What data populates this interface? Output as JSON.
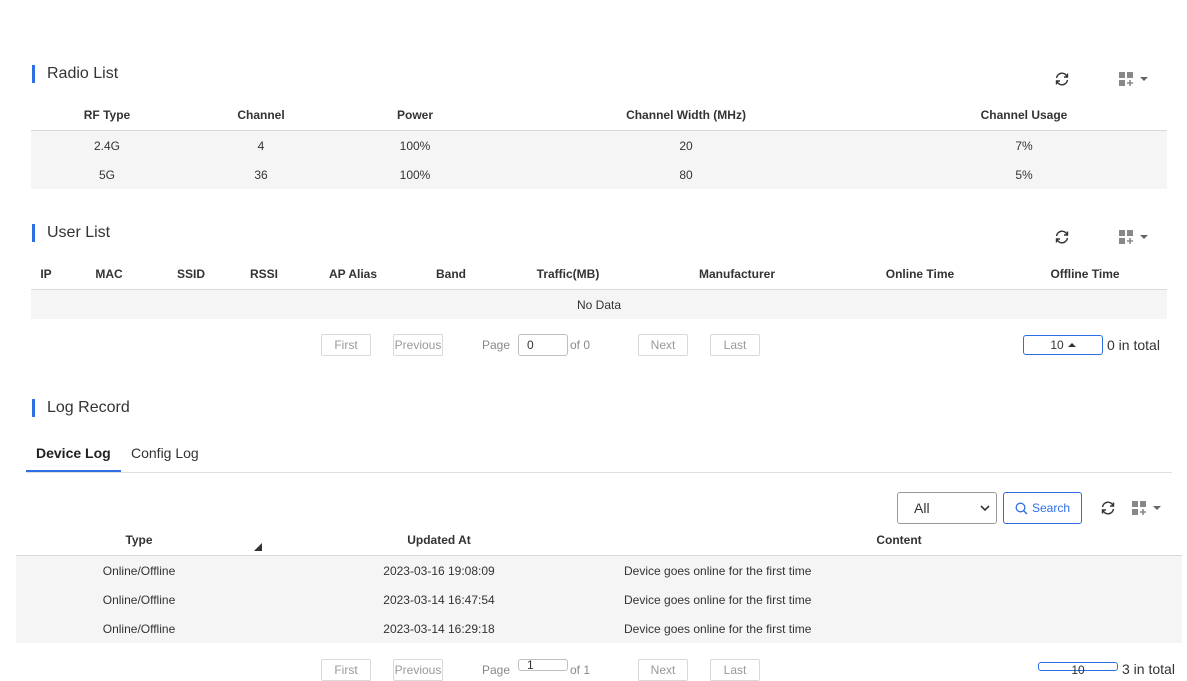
{
  "radio": {
    "title": "Radio List",
    "columns": [
      "RF Type",
      "Channel",
      "Power",
      "Channel Width (MHz)",
      "Channel Usage"
    ],
    "rows": [
      [
        "2.4G",
        "4",
        "100%",
        "20",
        "7%"
      ],
      [
        "5G",
        "36",
        "100%",
        "80",
        "5%"
      ]
    ]
  },
  "users": {
    "title": "User List",
    "columns": [
      "IP",
      "MAC",
      "SSID",
      "RSSI",
      "AP Alias",
      "Band",
      "Traffic(MB)",
      "Manufacturer",
      "Online Time",
      "Offline Time"
    ],
    "empty": "No Data",
    "pager": {
      "first": "First",
      "previous": "Previous",
      "page_label": "Page",
      "page_value": "0",
      "of_label": "of 0",
      "next": "Next",
      "last": "Last",
      "page_size": "10",
      "total": "0 in total"
    }
  },
  "log": {
    "title": "Log Record",
    "tabs": [
      "Device Log",
      "Config Log"
    ],
    "active_tab": "Device Log",
    "filter": {
      "selected": "All",
      "search_label": "Search"
    },
    "columns": [
      "Type",
      "Updated At",
      "Content"
    ],
    "rows": [
      [
        "Online/Offline",
        "2023-03-16 19:08:09",
        "Device goes online for the first time"
      ],
      [
        "Online/Offline",
        "2023-03-14 16:47:54",
        "Device goes online for the first time"
      ],
      [
        "Online/Offline",
        "2023-03-14 16:29:18",
        "Device goes online for the first time"
      ]
    ],
    "pager": {
      "first": "First",
      "previous": "Previous",
      "page_label": "Page",
      "page_value": "1",
      "of_label": "of 1",
      "next": "Next",
      "last": "Last",
      "page_size": "10",
      "total": "3 in total"
    }
  },
  "icons": {
    "refresh": "refresh-icon",
    "columns": "column-settings-icon",
    "caret": "caret-down-icon",
    "search": "search-icon",
    "sort": "sort-icon"
  },
  "colors": {
    "accent": "#2f6fe4",
    "row_alt": "#f5f5f5",
    "border": "#d9d9d9"
  }
}
